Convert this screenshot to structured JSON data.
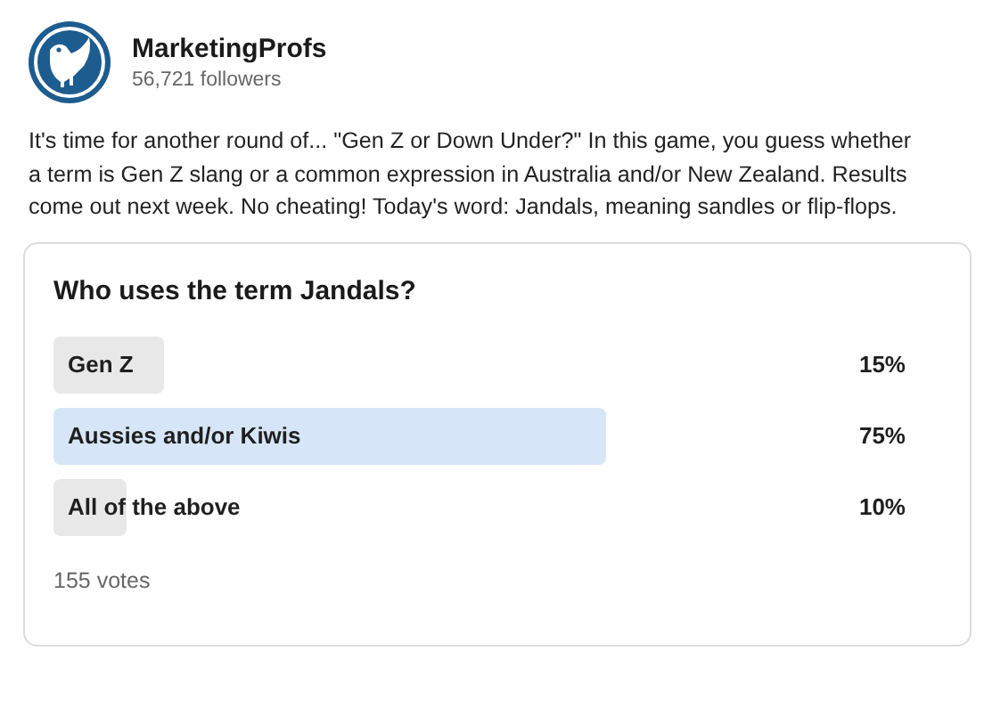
{
  "author": {
    "name": "MarketingProfs",
    "followers": "56,721 followers"
  },
  "post_text": "It's time for another round of... \"Gen Z or Down Under?\" In this game, you guess whether a term is Gen Z slang or a common expression in Australia and/or New Zealand. Results come out next week. No cheating! Today's word: Jandals, meaning sandles or flip-flops.",
  "poll": {
    "question": "Who uses the term Jandals?",
    "options": [
      {
        "label": "Gen Z",
        "percent": "15%",
        "selected": false
      },
      {
        "label": "Aussies and/or Kiwis",
        "percent": "75%",
        "selected": true
      },
      {
        "label": "All of the above",
        "percent": "10%",
        "selected": false
      }
    ],
    "votes": "155 votes"
  }
}
